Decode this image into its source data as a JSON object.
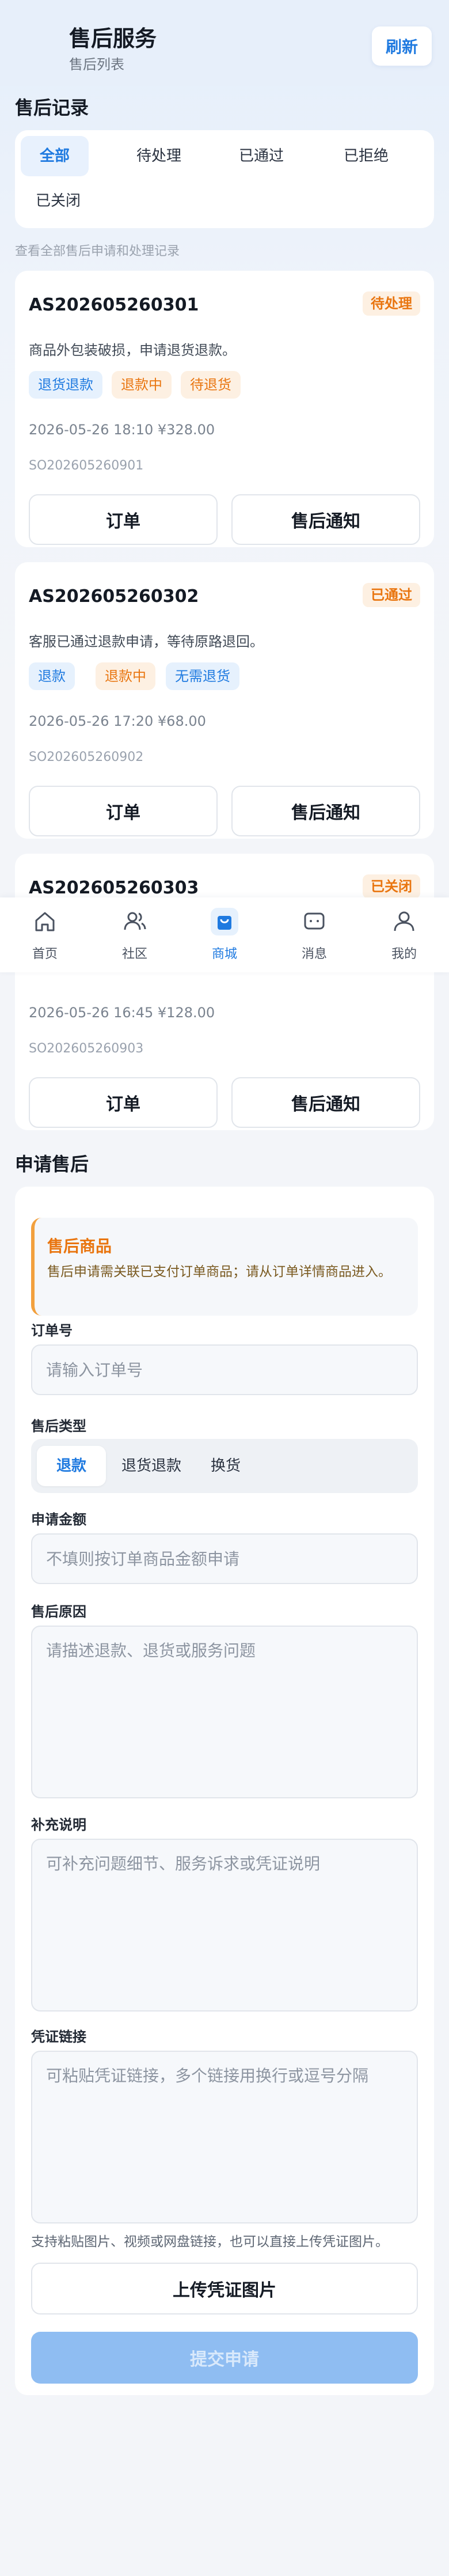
{
  "header": {
    "title": "售后服务",
    "subtitle": "售后列表",
    "refresh_label": "刷新"
  },
  "records": {
    "title": "售后记录",
    "tabs": [
      {
        "label": "全部",
        "active": true
      },
      {
        "label": "待处理"
      },
      {
        "label": "已通过"
      },
      {
        "label": "已拒绝"
      },
      {
        "label": "已关闭"
      }
    ],
    "hint": "查看全部售后申请和处理记录",
    "cards": [
      {
        "no": "AS202605260301",
        "status": "待处理",
        "desc": "商品外包装破损，申请退货退款。",
        "tags": [
          "退货退款",
          "退款中",
          "待退货"
        ],
        "meta": "2026-05-26 18:10   ¥328.00",
        "order": "SO202605260901",
        "order_btn": "订单",
        "notice_btn": "售后通知"
      },
      {
        "no": "AS202605260302",
        "status": "已通过",
        "desc": "客服已通过退款申请，等待原路退回。",
        "tags": [
          "退款",
          "退款中",
          "无需退货"
        ],
        "meta": "2026-05-26 17:20   ¥68.00",
        "order": "SO202605260902",
        "order_btn": "订单",
        "notice_btn": "售后通知"
      },
      {
        "no": "AS202605260303",
        "status": "已关闭",
        "meta": "2026-05-26 16:45   ¥128.00",
        "order": "SO202605260903",
        "order_btn": "订单",
        "notice_btn": "售后通知"
      }
    ]
  },
  "tabbar": [
    {
      "label": "首页",
      "icon": "home-icon"
    },
    {
      "label": "社区",
      "icon": "community-icon"
    },
    {
      "label": "商城",
      "icon": "shop-bag-icon",
      "active": true
    },
    {
      "label": "消息",
      "icon": "message-icon"
    },
    {
      "label": "我的",
      "icon": "user-icon"
    }
  ],
  "apply": {
    "title": "申请售后",
    "notice_title": "售后商品",
    "notice_text": "售后申请需关联已支付订单商品；请从订单详情商品进入。",
    "order_label": "订单号",
    "order_placeholder": "请输入订单号",
    "type_label": "售后类型",
    "types": [
      {
        "label": "退款",
        "active": true
      },
      {
        "label": "退货退款"
      },
      {
        "label": "换货"
      }
    ],
    "amount_label": "申请金额",
    "amount_placeholder": "不填则按订单商品金额申请",
    "reason_label": "售后原因",
    "reason_placeholder": "请描述退款、退货或服务问题",
    "extra_label": "补充说明",
    "extra_placeholder": "可补充问题细节、服务诉求或凭证说明",
    "proof_label": "凭证链接",
    "proof_placeholder": "可粘贴凭证链接，多个链接用换行或逗号分隔",
    "help": "支持粘贴图片、视频或网盘链接，也可以直接上传凭证图片。",
    "upload_label": "上传凭证图片",
    "submit_label": "提交申请"
  },
  "colors": {
    "accent": "#1f7ae0",
    "warning": "#e9750f",
    "submit_disabled": "#8fbdf2"
  }
}
